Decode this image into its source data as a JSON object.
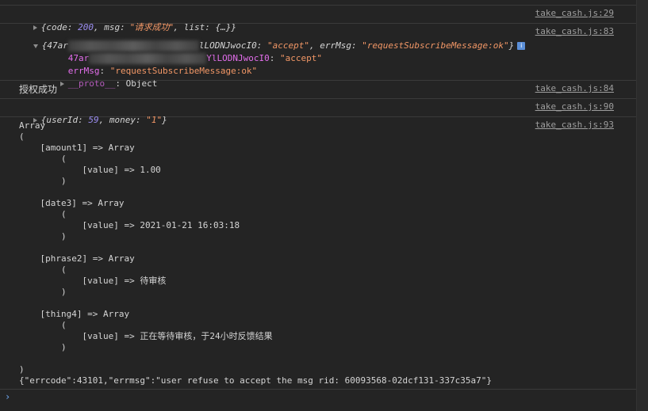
{
  "messages": {
    "m1": {
      "text_a": "{code: ",
      "code": "200",
      "text_b": ", msg: ",
      "msg": "\"请求成功\"",
      "text_c": ", list: {…}}",
      "source": "take_cash.js:29"
    },
    "m2": {
      "prefix": "{47ar",
      "suffix_key": "lLODNJwocI0",
      "sep": ": ",
      "value": "\"accept\"",
      "errmsg_key": ", errMsg: ",
      "errmsg_val": "\"requestSubscribeMessage:ok\"",
      "close": "}",
      "info_icon": "i",
      "source": "take_cash.js:83",
      "expanded": {
        "row1_prefix": "47ar",
        "row1_key": "YlLODNJwocI0",
        "row1_val": "\"accept\"",
        "row2_key": "errMsg",
        "row2_val": "\"requestSubscribeMessage:ok\"",
        "row3_key": "__proto__",
        "row3_val": "Object"
      }
    },
    "m3": {
      "text": "授权成功",
      "source": "take_cash.js:84"
    },
    "m4": {
      "text_a": "{userId: ",
      "userId": "59",
      "text_b": ", money: ",
      "money": "\"1\"",
      "text_c": "}",
      "source": "take_cash.js:90"
    },
    "m5": {
      "source": "take_cash.js:93",
      "lines": [
        "Array",
        "(",
        "    [amount1] => Array",
        "        (",
        "            [value] => 1.00",
        "        )",
        "",
        "    [date3] => Array",
        "        (",
        "            [value] => 2021-01-21 16:03:18",
        "        )",
        "",
        "    [phrase2] => Array",
        "        (",
        "            [value] => 待审核",
        "        )",
        "",
        "    [thing4] => Array",
        "        (",
        "            [value] => 正在等待审核，于24小时反馈结果",
        "        )",
        "",
        ")",
        "{\"errcode\":43101,\"errmsg\":\"user refuse to accept the msg rid: 60093568-02dcf131-337c35a7\"}"
      ]
    }
  },
  "prompt_symbol": "›",
  "colors": {
    "background": "#242424",
    "number": "#9b8df0",
    "string": "#f29766",
    "link": "#9e9e9e"
  }
}
